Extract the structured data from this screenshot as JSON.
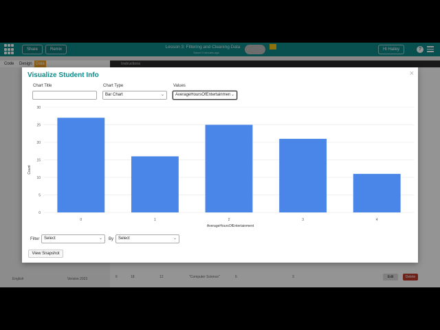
{
  "topbar": {
    "share_label": "Share",
    "remix_label": "Remix",
    "lesson_title": "Lesson 3: Filtering and Cleaning Data",
    "saved_text": "Saved 3 minutes ago",
    "user_label": "Hi Hailey",
    "help_label": "?"
  },
  "workspace": {
    "tabs": [
      "Code",
      "Design",
      "Data"
    ],
    "instructions_label": "Instructions"
  },
  "background": {
    "language": "English",
    "version_label": "Version 2023",
    "edit_label": "Edit",
    "delete_label": "Delete",
    "row_cells": [
      "6",
      "18",
      "12",
      "\"Computer Science\"",
      "6",
      "3"
    ],
    "colors": {
      "edit": "#2b8a3e",
      "delete": "#c0392b"
    }
  },
  "modal": {
    "title": "Visualize Student Info",
    "close_label": "×",
    "chart_title_label": "Chart Title",
    "chart_title_value": "",
    "chart_type_label": "Chart Type",
    "chart_type_value": "Bar Chart",
    "values_label": "Values",
    "values_value": "AverageHoursOfEntertainmen",
    "filter_label": "Filter",
    "filter_value": "Select",
    "by_label": "By",
    "by_value": "Select",
    "snapshot_label": "View Snapshot"
  },
  "chart_data": {
    "type": "bar",
    "categories": [
      "0",
      "1",
      "2",
      "3",
      "4"
    ],
    "values": [
      27,
      16,
      25,
      21,
      11
    ],
    "xlabel": "AverageHoursOfEntertainment",
    "ylabel": "Count",
    "ylim": [
      0,
      30
    ],
    "yticks": [
      0,
      5,
      10,
      15,
      20,
      25,
      30
    ],
    "grid": true,
    "bar_color": "#4a86e8"
  }
}
